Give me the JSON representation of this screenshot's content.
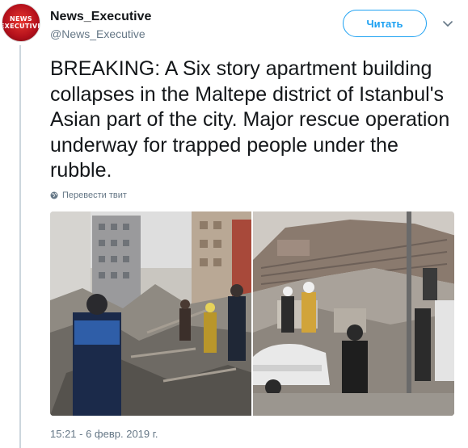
{
  "author": {
    "avatar_line1": "NEWS",
    "avatar_line2": "EXECUTIVE",
    "display_name": "News_Executive",
    "handle": "@News_Executive"
  },
  "follow_label": "Читать",
  "tweet": {
    "text": "BREAKING: A Six story apartment building collapses in the Maltepe district of Istanbul's Asian part of the city. Major rescue operation underway for trapped people under the rubble.",
    "translate_label": "Перевести твит",
    "timestamp": "15:21 - 6 февр. 2019 г."
  },
  "media": {
    "photos": [
      {
        "icon": "photo-rescue-workers"
      },
      {
        "icon": "photo-collapsed-building"
      }
    ]
  },
  "colors": {
    "accent": "#1da1f2",
    "text": "#14171a",
    "secondary": "#657786",
    "thread_line": "#ccd6dd"
  },
  "icons": {
    "caret": "chevron-down-icon",
    "translate": "globe-icon"
  }
}
